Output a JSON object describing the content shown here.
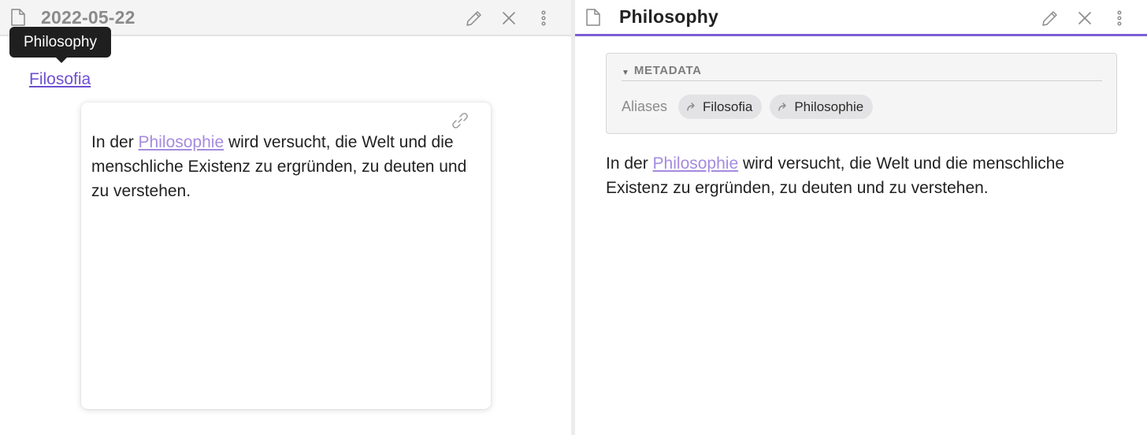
{
  "left_pane": {
    "title": "2022-05-22",
    "tooltip": "Philosophy",
    "link": "Filosofia",
    "preview": {
      "text_before": "In der ",
      "link_text": "Philosophie",
      "text_after": " wird versucht, die Welt und die menschliche Existenz zu ergründen, zu deuten und zu verstehen."
    }
  },
  "right_pane": {
    "title": "Philosophy",
    "metadata": {
      "title": "METADATA",
      "aliases_label": "Aliases",
      "aliases": [
        "Filosofia",
        "Philosophie"
      ]
    },
    "body": {
      "text_before": "In der ",
      "link_text": "Philosophie",
      "text_after": " wird versucht, die Welt und die menschliche Existenz zu ergründen, zu deuten und zu verstehen."
    }
  },
  "colors": {
    "accent": "#7b5fd6",
    "link": "#6e4fd1",
    "internal_link": "#a58bdf",
    "icon": "#8a8a8a"
  },
  "icons": {
    "file": "file-icon",
    "edit": "pencil-icon",
    "close": "close-icon",
    "more": "more-vertical-icon",
    "link": "link-icon",
    "alias": "arrow-forward-icon",
    "collapse": "triangle-down-icon"
  }
}
